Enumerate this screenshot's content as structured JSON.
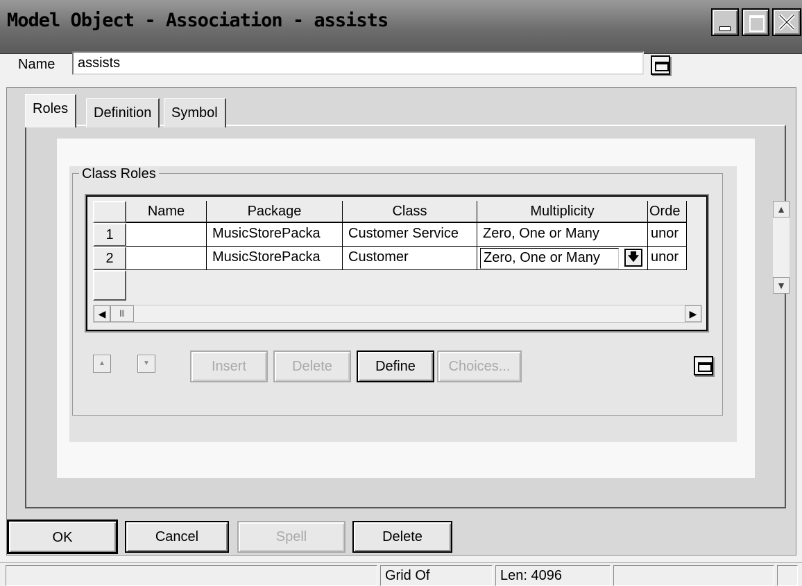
{
  "window": {
    "title": "Model Object - Association - assists",
    "icons": [
      "minimize-icon",
      "maximize-icon",
      "close-icon"
    ]
  },
  "name_field": {
    "label": "Name",
    "value": "assists"
  },
  "tabs": [
    {
      "label": "Roles",
      "active": true
    },
    {
      "label": "Definition",
      "active": false
    },
    {
      "label": "Symbol",
      "active": false
    }
  ],
  "class_roles": {
    "group_title": "Class Roles",
    "columns": [
      "Name",
      "Package",
      "Class",
      "Multiplicity",
      "Orde"
    ],
    "rows": [
      {
        "num": "1",
        "name": "",
        "package": "MusicStorePacka",
        "class": "Customer Service",
        "multiplicity": "Zero, One or Many",
        "order": "unor"
      },
      {
        "num": "2",
        "name": "",
        "package": "MusicStorePacka",
        "class": "Customer",
        "multiplicity": "Zero, One or Many",
        "order": "unor"
      }
    ],
    "buttons": {
      "insert": "Insert",
      "delete": "Delete",
      "define": "Define",
      "choices": "Choices..."
    }
  },
  "footer_buttons": {
    "ok": "OK",
    "cancel": "Cancel",
    "spell": "Spell",
    "delete": "Delete"
  },
  "status_bar": [
    "",
    "Grid Of",
    "Len: 4096",
    ""
  ]
}
